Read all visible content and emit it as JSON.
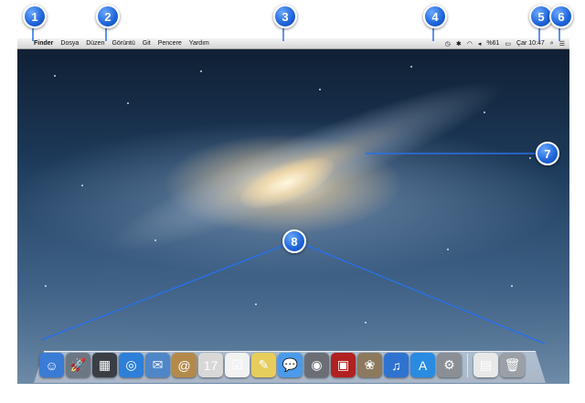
{
  "menubar": {
    "apple_glyph": "",
    "app_name": "Finder",
    "menus": [
      "Dosya",
      "Düzen",
      "Görüntü",
      "Git",
      "Pencere",
      "Yardım"
    ],
    "status": {
      "battery_text": "%61",
      "clock": "Çar 10:47"
    }
  },
  "callouts": [
    "1",
    "2",
    "3",
    "4",
    "5",
    "6",
    "7",
    "8"
  ],
  "dock": {
    "apps": [
      {
        "name": "finder-icon",
        "glyph": "☺",
        "color": "#3a7bd5"
      },
      {
        "name": "launchpad-icon",
        "glyph": "🚀",
        "color": "#6d7783"
      },
      {
        "name": "mission-control-icon",
        "glyph": "▦",
        "color": "#3a3f46"
      },
      {
        "name": "safari-icon",
        "glyph": "◎",
        "color": "#2d7fd9"
      },
      {
        "name": "mail-icon",
        "glyph": "✉",
        "color": "#4f86c7"
      },
      {
        "name": "contacts-icon",
        "glyph": "@",
        "color": "#b38a4b"
      },
      {
        "name": "calendar-icon",
        "glyph": "17",
        "color": "#d8d8d8"
      },
      {
        "name": "reminders-icon",
        "glyph": "☑",
        "color": "#f2f2f2"
      },
      {
        "name": "notes-icon",
        "glyph": "✎",
        "color": "#e6cd5c"
      },
      {
        "name": "messages-icon",
        "glyph": "💬",
        "color": "#4b9bea"
      },
      {
        "name": "facetime-icon",
        "glyph": "◉",
        "color": "#6b6f75"
      },
      {
        "name": "photo-booth-icon",
        "glyph": "▣",
        "color": "#b0211f"
      },
      {
        "name": "iphoto-icon",
        "glyph": "❀",
        "color": "#8d7a5e"
      },
      {
        "name": "itunes-icon",
        "glyph": "♫",
        "color": "#2f73d1"
      },
      {
        "name": "app-store-icon",
        "glyph": "A",
        "color": "#2a8be3"
      },
      {
        "name": "system-preferences-icon",
        "glyph": "⚙",
        "color": "#8a8f96"
      }
    ],
    "docs": [
      {
        "name": "documents-stack-icon",
        "glyph": "▤",
        "color": "#e8e8e8"
      },
      {
        "name": "trash-icon",
        "glyph": "🗑",
        "color": "#9aa0a6"
      }
    ]
  }
}
